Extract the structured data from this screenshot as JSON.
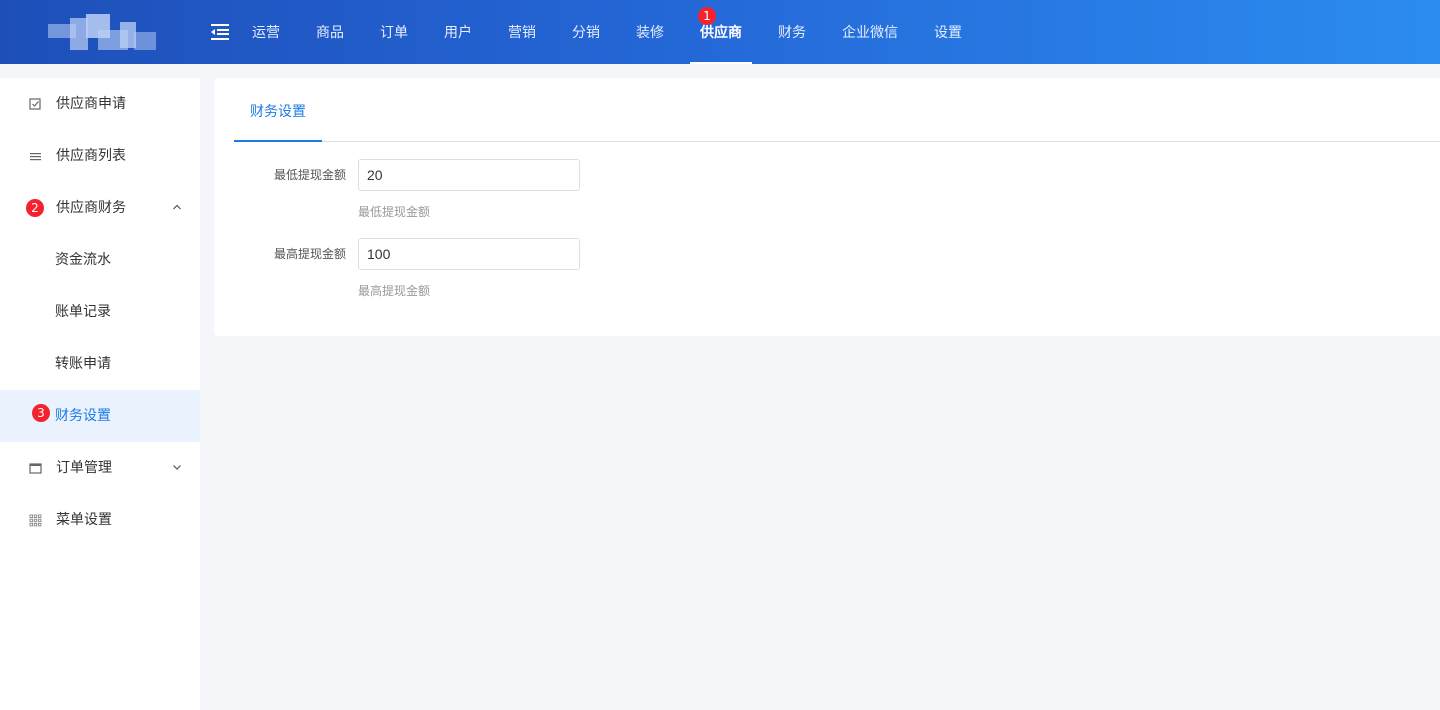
{
  "header": {
    "nav": [
      {
        "label": "运营"
      },
      {
        "label": "商品"
      },
      {
        "label": "订单"
      },
      {
        "label": "用户"
      },
      {
        "label": "营销"
      },
      {
        "label": "分销"
      },
      {
        "label": "装修"
      },
      {
        "label": "供应商",
        "active": true,
        "badge": "1"
      },
      {
        "label": "财务"
      },
      {
        "label": "企业微信"
      },
      {
        "label": "设置"
      }
    ]
  },
  "sidebar": {
    "items": [
      {
        "label": "供应商申请",
        "icon": "checkbox-icon"
      },
      {
        "label": "供应商列表",
        "icon": "list-icon"
      },
      {
        "label": "供应商财务",
        "badge": "2",
        "expanded": true
      },
      {
        "label": "资金流水"
      },
      {
        "label": "账单记录"
      },
      {
        "label": "转账申请"
      },
      {
        "label": "财务设置",
        "badge": "3",
        "active": true
      },
      {
        "label": "订单管理",
        "icon": "window-icon"
      },
      {
        "label": "菜单设置",
        "icon": "grid-icon"
      }
    ]
  },
  "main": {
    "tab": "财务设置",
    "form": {
      "min": {
        "label": "最低提现金额",
        "value": "20",
        "help": "最低提现金额"
      },
      "max": {
        "label": "最高提现金额",
        "value": "100",
        "help": "最高提现金额"
      }
    }
  },
  "colors": {
    "accent": "#1d7be6",
    "badge": "#f5222d",
    "header_start": "#1e4fb9",
    "header_end": "#2c8cf0"
  }
}
